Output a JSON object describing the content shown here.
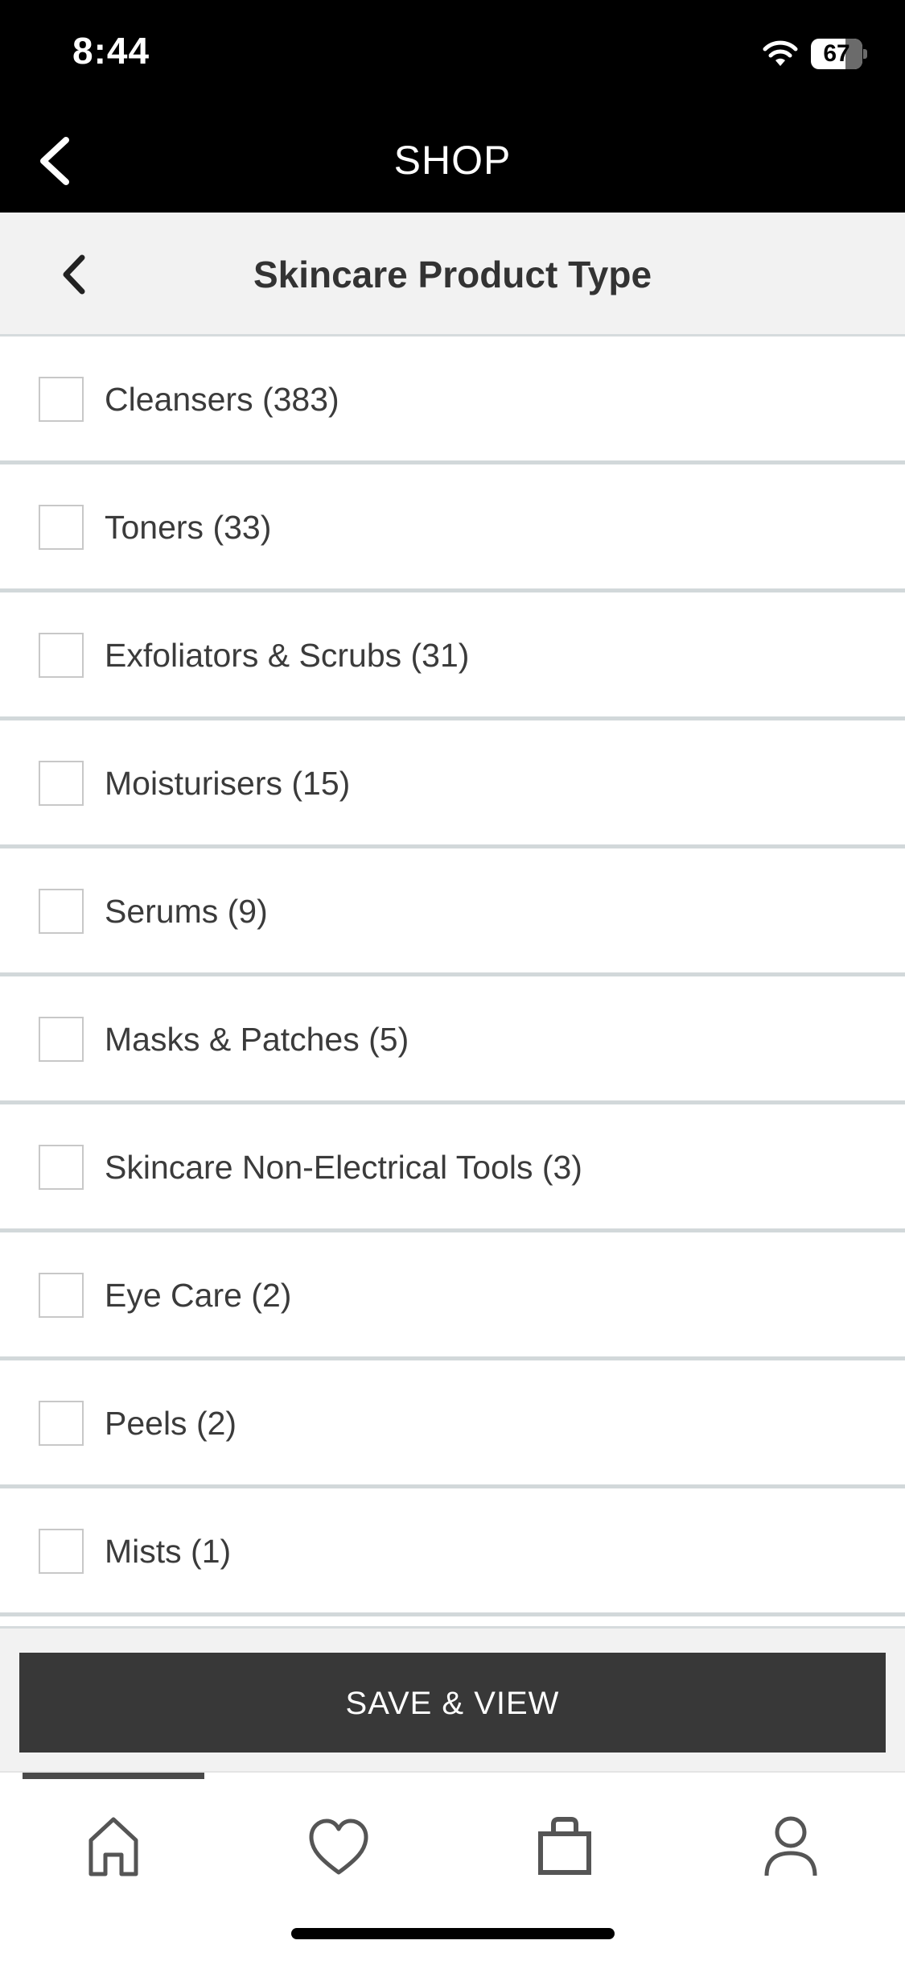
{
  "status_bar": {
    "time": "8:44",
    "battery": "67",
    "battery_level_percent": 67
  },
  "header": {
    "title": "SHOP",
    "back_icon": "chevron-left-icon"
  },
  "subheader": {
    "title": "Skincare Product Type",
    "back_icon": "chevron-left-icon"
  },
  "items": [
    {
      "label": "Cleansers (383)",
      "checked": false
    },
    {
      "label": "Toners (33)",
      "checked": false
    },
    {
      "label": "Exfoliators & Scrubs (31)",
      "checked": false
    },
    {
      "label": "Moisturisers (15)",
      "checked": false
    },
    {
      "label": "Serums (9)",
      "checked": false
    },
    {
      "label": "Masks & Patches (5)",
      "checked": false
    },
    {
      "label": "Skincare Non-Electrical Tools (3)",
      "checked": false
    },
    {
      "label": "Eye Care (2)",
      "checked": false
    },
    {
      "label": "Peels (2)",
      "checked": false
    },
    {
      "label": "Mists (1)",
      "checked": false
    }
  ],
  "footer": {
    "save_label": "SAVE & VIEW"
  },
  "tabbar": {
    "tabs": [
      {
        "icon": "home-icon",
        "active": true
      },
      {
        "icon": "heart-icon",
        "active": false
      },
      {
        "icon": "bag-icon",
        "active": false
      },
      {
        "icon": "profile-icon",
        "active": false
      }
    ]
  },
  "colors": {
    "header_bg": "#000000",
    "subheader_bg": "#f2f2f2",
    "button_bg": "#383838",
    "divider": "#d2d8da"
  }
}
